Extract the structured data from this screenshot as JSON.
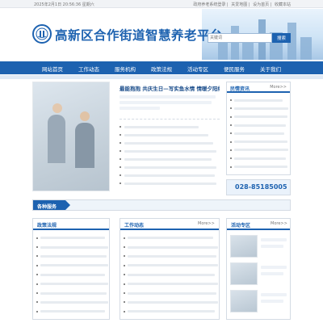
{
  "topbar": {
    "date": "2025年2月1日 20:56:36 星期六",
    "links": [
      "政府养老系统登录",
      "关爱地图",
      "设为首页",
      "收藏本站"
    ]
  },
  "header": {
    "site_title": "高新区合作街道智慧养老平台",
    "search_placeholder": "关键词",
    "search_button": "搜索",
    "logo_icon": "organization-emblem-icon"
  },
  "nav": {
    "items": [
      "网站首页",
      "工作动态",
      "服务机构",
      "政策法规",
      "活动专区",
      "便民服务",
      "关于我们"
    ]
  },
  "lead": {
    "title": "最能抱抱 共庆生日—写实鱼水情 情暖夕阳红"
  },
  "sidebox": {
    "title": "民情资讯",
    "more": "More>>"
  },
  "hotline": {
    "number": "028-85185005"
  },
  "service": {
    "label": "各种服务"
  },
  "columns": {
    "policy": {
      "title": "政策法规"
    },
    "work": {
      "title": "工作动态",
      "more": "More>>"
    },
    "activity": {
      "title": "活动专区",
      "more": "More>>"
    }
  },
  "colors": {
    "brand": "#1d62b0",
    "nav_bg": "#1d62b0",
    "topbar_bg": "#f1f3f6"
  }
}
